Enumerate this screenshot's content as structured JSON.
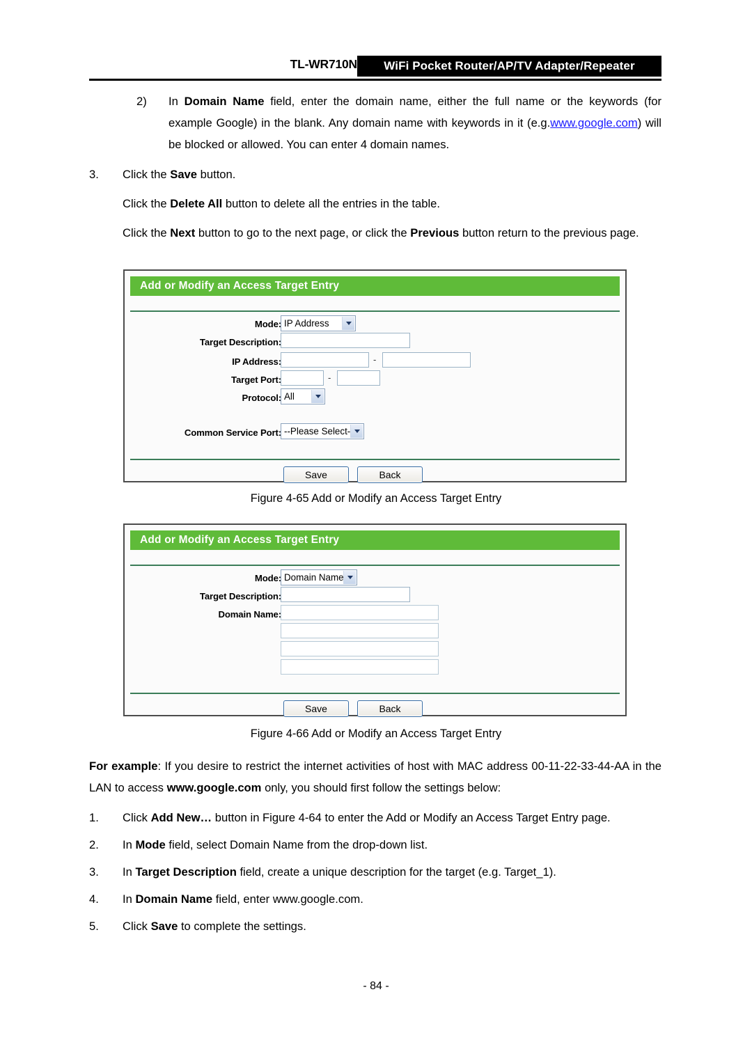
{
  "header": {
    "model": "TL-WR710N",
    "product": "WiFi Pocket Router/AP/TV Adapter/Repeater"
  },
  "body_text": {
    "item2_marker": "2)",
    "item2_line": "In Domain Name field, enter the domain name, either the full name or the keywords (for example Google) in the blank. Any domain name with keywords in it (e.g.www.google.com) will be blocked or allowed. You can enter 4 domain names.",
    "item2_a": "In ",
    "item2_b_domain": "Domain Name",
    "item2_c": " field, enter the domain name, either the full name or the keywords (for example Google) in the blank. Any domain name with keywords in it (e.g.",
    "item2_link": "www.google.com",
    "item2_d": ") will be blocked or allowed. You can enter 4 domain names.",
    "item3_marker": "3.",
    "item3_a": "Click the ",
    "item3_b": "Save",
    "item3_c": " button.",
    "para_delete_a": "Click the ",
    "para_delete_b": "Delete All",
    "para_delete_c": " button to delete all the entries in the table.",
    "para_next_a": "Click the ",
    "para_next_b": "Next",
    "para_next_c": " button to go to the next page, or click the ",
    "para_next_d": "Previous",
    "para_next_e": " button return to the previous page."
  },
  "figure1": {
    "caption": "Figure 4-65    Add or Modify an Access Target Entry",
    "panel_title": "Add or Modify an Access Target Entry",
    "labels": {
      "mode": "Mode:",
      "target_description": "Target Description:",
      "ip_address": "IP Address:",
      "target_port": "Target Port:",
      "protocol": "Protocol:",
      "common_service_port": "Common Service Port:"
    },
    "values": {
      "mode": "IP Address",
      "target_description": "",
      "ip_address_start": "",
      "ip_address_end": "",
      "target_port_start": "",
      "target_port_end": "",
      "protocol": "All",
      "common_service_port": "--Please Select--"
    },
    "separator": "-",
    "buttons": {
      "save": "Save",
      "back": "Back"
    }
  },
  "figure2": {
    "caption": "Figure 4-66    Add or Modify an Access Target Entry",
    "panel_title": "Add or Modify an Access Target Entry",
    "labels": {
      "mode": "Mode:",
      "target_description": "Target Description:",
      "domain_name": "Domain Name:"
    },
    "values": {
      "mode": "Domain Name",
      "target_description": "",
      "domain_name_1": "",
      "domain_name_2": "",
      "domain_name_3": "",
      "domain_name_4": ""
    },
    "buttons": {
      "save": "Save",
      "back": "Back"
    }
  },
  "example": {
    "lead": "For example",
    "text_a": ": If you desire to restrict the internet activities of host with MAC address 00-11-22-33-44-AA in the LAN to access ",
    "domain": "www.google.com",
    "text_b": " only, you should first follow the settings below:"
  },
  "steps": [
    {
      "marker": "1.",
      "a": "Click ",
      "b": "Add New…",
      "c": " button in Figure 4-64 to enter the Add or Modify an Access Target Entry page."
    },
    {
      "marker": "2.",
      "a": "In ",
      "b": "Mode",
      "c": " field, select Domain Name from the drop-down list."
    },
    {
      "marker": "3.",
      "a": "In ",
      "b": "Target Description",
      "c": " field, create a unique description for the target (e.g. Target_1)."
    },
    {
      "marker": "4.",
      "a": "In ",
      "b": "Domain Name",
      "c": " field, enter www.google.com."
    },
    {
      "marker": "5.",
      "a": "Click ",
      "b": "Save",
      "c": " to complete the settings."
    }
  ],
  "footer": {
    "page_number": "- 84 -"
  },
  "colors": {
    "brand_green": "#5fbb39",
    "rule_green": "#3b7d58",
    "link_blue": "#1a1aff",
    "header_black": "#000000"
  }
}
